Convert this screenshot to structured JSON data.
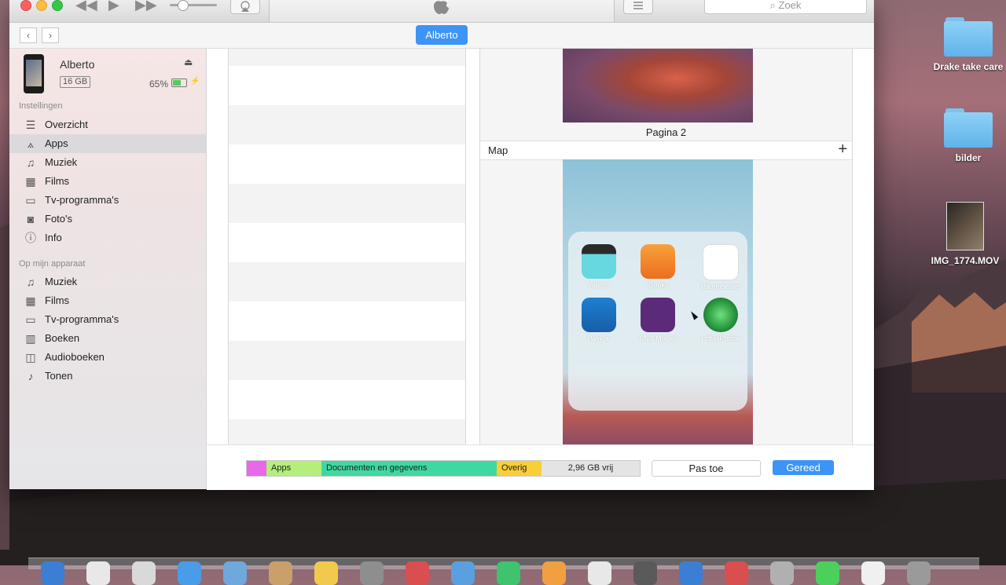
{
  "window": {
    "search_placeholder": "Zoek",
    "device_pill": "Alberto",
    "device": {
      "name": "Alberto",
      "capacity": "16 GB",
      "battery": "65%",
      "battery_level": 0.65
    },
    "sidebar": {
      "settings_label": "Instellingen",
      "settings_items": [
        {
          "label": "Overzicht",
          "icon": "summary-icon"
        },
        {
          "label": "Apps",
          "icon": "apps-icon",
          "selected": true
        },
        {
          "label": "Muziek",
          "icon": "music-icon"
        },
        {
          "label": "Films",
          "icon": "film-icon"
        },
        {
          "label": "Tv-programma's",
          "icon": "tv-icon"
        },
        {
          "label": "Foto's",
          "icon": "camera-icon"
        },
        {
          "label": "Info",
          "icon": "info-icon"
        }
      ],
      "device_label": "Op mijn apparaat",
      "device_items": [
        {
          "label": "Muziek",
          "icon": "music-icon"
        },
        {
          "label": "Films",
          "icon": "film-icon"
        },
        {
          "label": "Tv-programma's",
          "icon": "tv-icon"
        },
        {
          "label": "Boeken",
          "icon": "book-icon"
        },
        {
          "label": "Audioboeken",
          "icon": "audiobook-icon"
        },
        {
          "label": "Tonen",
          "icon": "bell-icon"
        }
      ]
    },
    "screens": {
      "page_label": "Pagina 2",
      "folder_label": "Map",
      "folder_apps": [
        {
          "name": "Video's",
          "color": "#67d8df"
        },
        {
          "name": "iBooks",
          "color": "#f08a2a"
        },
        {
          "name": "Påminnelser",
          "color": "#ffffff"
        },
        {
          "name": "PayPal",
          "color": "#1c6fbf"
        },
        {
          "name": "SNS Mobiel",
          "color": "#5b2b7a"
        },
        {
          "name": "Hitta iPhone",
          "color": "#2b9a40"
        }
      ]
    },
    "storage_bar": {
      "segments": [
        {
          "label": "",
          "color": "#e967e9",
          "fraction": 0.05
        },
        {
          "label": "Apps",
          "color": "#b4ef7c",
          "fraction": 0.14
        },
        {
          "label": "Documenten en gegevens",
          "color": "#40d8a2",
          "fraction": 0.446
        },
        {
          "label": "Overig",
          "color": "#f8cf38",
          "fraction": 0.114
        },
        {
          "label": "2,96 GB vrij",
          "color": "#e4e4e4",
          "fraction": 0.25
        }
      ]
    },
    "buttons": {
      "apply": "Pas toe",
      "done": "Gereed"
    }
  },
  "desktop": {
    "icons": [
      {
        "label": "Drake take care",
        "type": "folder"
      },
      {
        "label": "bilder",
        "type": "folder"
      },
      {
        "label": "IMG_1774.MOV",
        "type": "movie"
      }
    ]
  }
}
